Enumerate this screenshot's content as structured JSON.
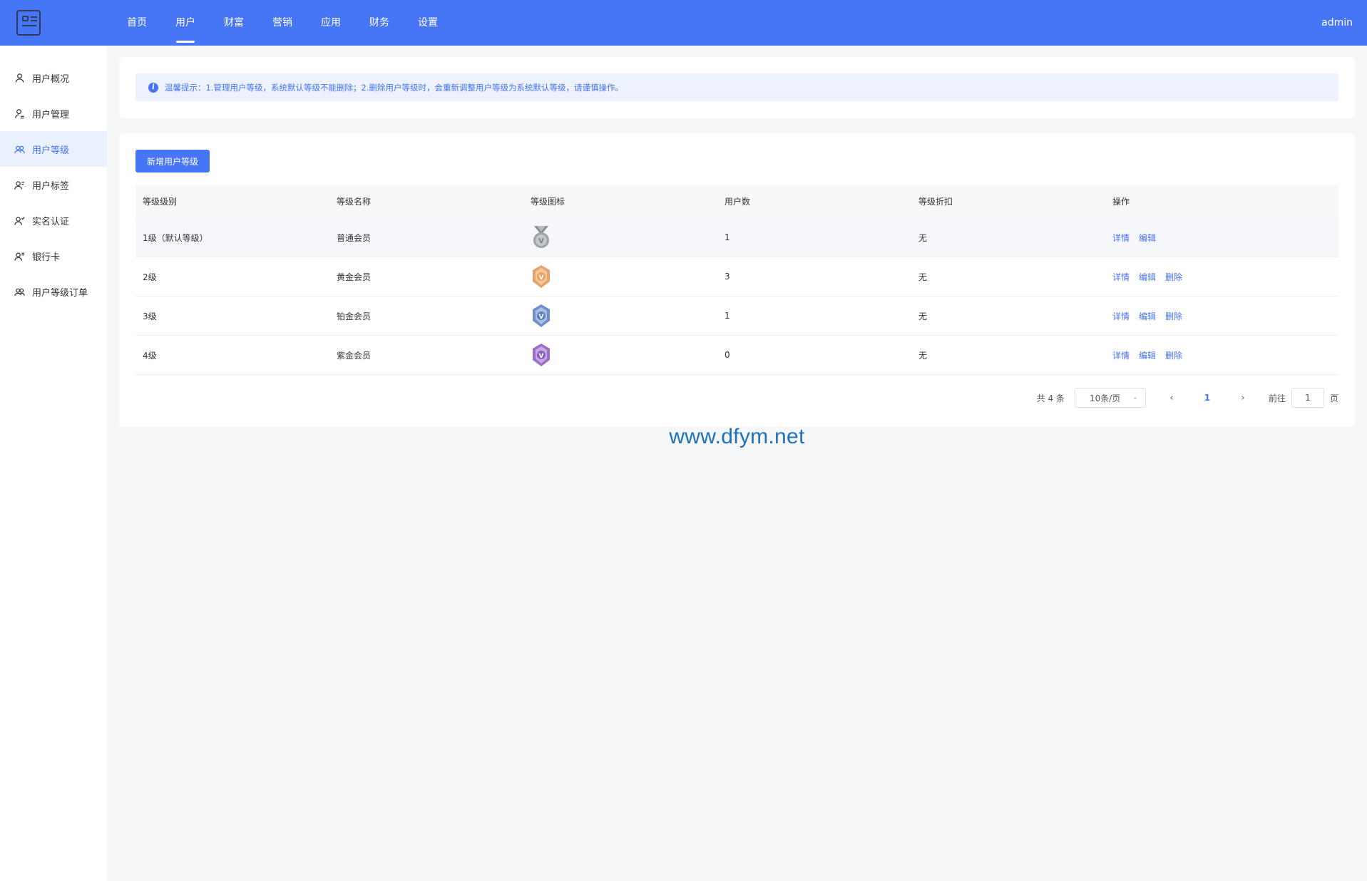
{
  "header": {
    "nav": [
      {
        "label": "首页",
        "active": false
      },
      {
        "label": "用户",
        "active": true
      },
      {
        "label": "财富",
        "active": false
      },
      {
        "label": "营销",
        "active": false
      },
      {
        "label": "应用",
        "active": false
      },
      {
        "label": "财务",
        "active": false
      },
      {
        "label": "设置",
        "active": false
      }
    ],
    "user": "admin"
  },
  "sidebar": {
    "items": [
      {
        "label": "用户概况",
        "icon": "user-icon",
        "active": false
      },
      {
        "label": "用户管理",
        "icon": "user-manage-icon",
        "active": false
      },
      {
        "label": "用户等级",
        "icon": "users-icon",
        "active": true
      },
      {
        "label": "用户标签",
        "icon": "user-tag-icon",
        "active": false
      },
      {
        "label": "实名认证",
        "icon": "user-verify-icon",
        "active": false
      },
      {
        "label": "银行卡",
        "icon": "user-card-icon",
        "active": false
      },
      {
        "label": "用户等级订单",
        "icon": "users-icon",
        "active": false
      }
    ]
  },
  "notice": {
    "icon": "info-icon",
    "text": "温馨提示：1.管理用户等级，系统默认等级不能删除；2.删除用户等级时，会重新调整用户等级为系统默认等级，请谨慎操作。"
  },
  "toolbar": {
    "add_label": "新增用户等级"
  },
  "table": {
    "columns": [
      "等级级别",
      "等级名称",
      "等级图标",
      "用户数",
      "等级折扣",
      "操作"
    ],
    "rows": [
      {
        "level": "1级（默认等级）",
        "name": "普通会员",
        "icon": "silver-medal-icon",
        "users": "1",
        "discount": "无",
        "ops": [
          "详情",
          "编辑"
        ]
      },
      {
        "level": "2级",
        "name": "黄金会员",
        "icon": "bronze-medal-icon",
        "users": "3",
        "discount": "无",
        "ops": [
          "详情",
          "编辑",
          "删除"
        ]
      },
      {
        "level": "3级",
        "name": "铂金会员",
        "icon": "blue-medal-icon",
        "users": "1",
        "discount": "无",
        "ops": [
          "详情",
          "编辑",
          "删除"
        ]
      },
      {
        "level": "4级",
        "name": "紫金会员",
        "icon": "purple-medal-icon",
        "users": "0",
        "discount": "无",
        "ops": [
          "详情",
          "编辑",
          "删除"
        ]
      }
    ]
  },
  "pagination": {
    "total": "共 4 条",
    "page_size": "10条/页",
    "current": "1",
    "goto_label": "前往",
    "goto_value": "1",
    "page_unit": "页"
  },
  "watermark": "www.dfym.net",
  "colors": {
    "primary": "#4675f6",
    "notice_bg": "#edf2fe",
    "page_bg": "#f5f6f8"
  }
}
